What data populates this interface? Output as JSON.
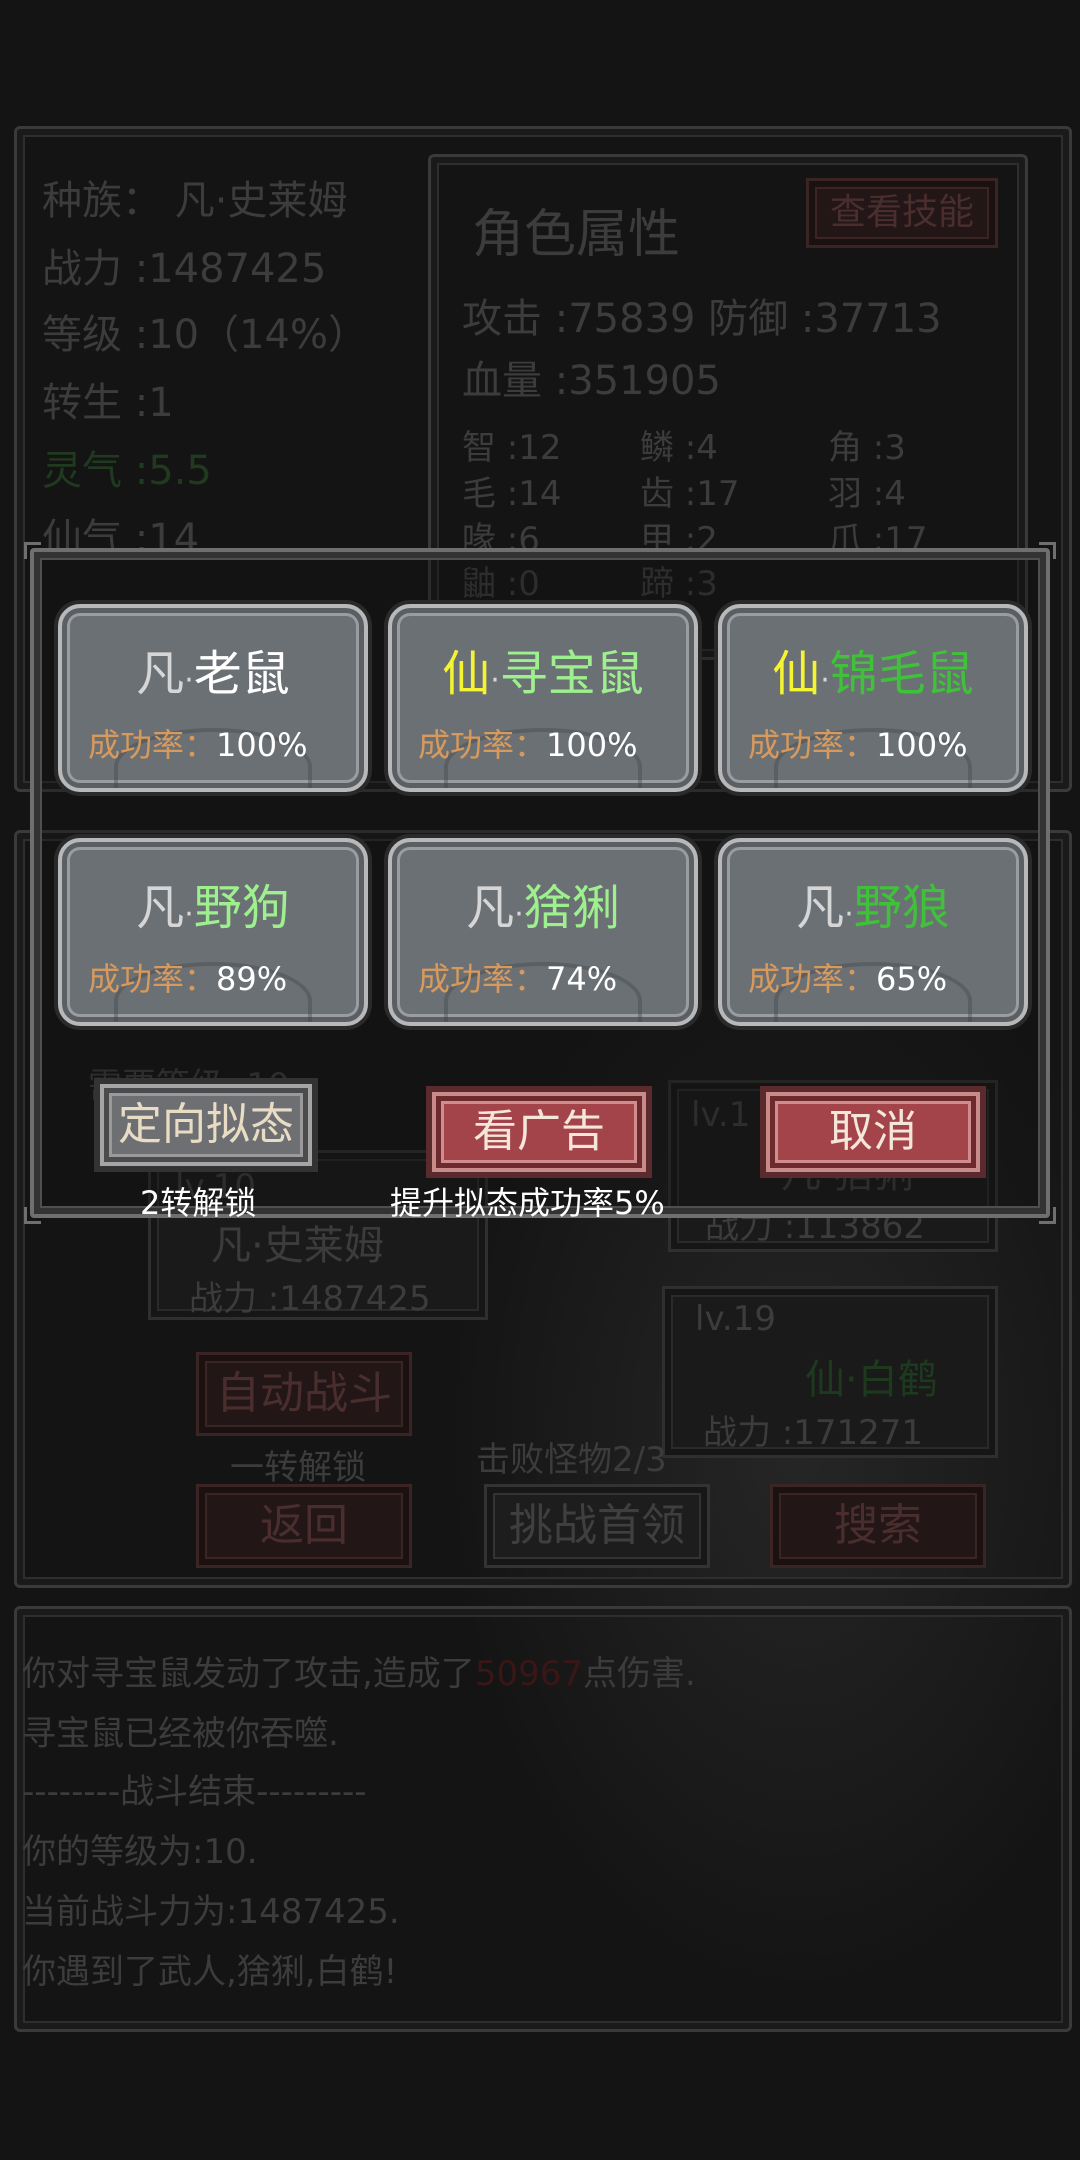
{
  "background": {
    "stats": [
      "种族：  凡·史莱姆",
      "战力 :1487425",
      "等级 :10（14%）",
      "转生 :1",
      "灵气 :5.5",
      "仙气 :14"
    ],
    "attributes": {
      "title": "角色属性",
      "skill_button": "查看技能",
      "attack_defense": "攻击 :75839   防御 :37713",
      "hp": "血量 :351905",
      "traits": [
        [
          "智 :12",
          "鳞 :4",
          "角 :3"
        ],
        [
          "毛 :14",
          "齿 :17",
          "羽 :4"
        ],
        [
          "喙 :6",
          "甲 :2",
          "爪 :17"
        ],
        [
          "鼬 :0",
          "蹄 :3",
          ""
        ]
      ]
    },
    "battle": {
      "level_req": "需要等级 :10",
      "player_card": {
        "level": "lv.10",
        "name": "凡·史莱姆",
        "power": "战力 :1487425"
      },
      "enemy_cards": [
        {
          "level": "lv.1",
          "name": "凡·猞猁",
          "power": "战力 :113862"
        },
        {
          "level": "lv.19",
          "name": "仙·白鹤",
          "power": "战力 :171271"
        }
      ],
      "auto_battle": "自动战斗",
      "auto_unlock": "一转解锁",
      "defeated": "击败怪物2/3",
      "back": "返回",
      "boss": "挑战首领",
      "search": "搜索"
    },
    "log": {
      "line1_pre": "你对寻宝鼠发动了攻击,造成了",
      "line1_damage": "50967",
      "line1_post": "点伤害.",
      "lines": [
        "寻宝鼠已经被你吞噬.",
        "--------战斗结束---------",
        "你的等级为:10.",
        "当前战斗力为:1487425.",
        "你遇到了武人,猞猁,白鹤!"
      ]
    }
  },
  "dialog": {
    "cards": [
      {
        "prefix": "凡",
        "prefix_color": "#d6d6d6",
        "name": "老鼠",
        "name_color": "#ffffff",
        "rate_label": "成功率：",
        "rate": "100%"
      },
      {
        "prefix": "仙",
        "prefix_color": "#f4f432",
        "name": "寻宝鼠",
        "name_color": "#9ef08e",
        "rate_label": "成功率：",
        "rate": "100%"
      },
      {
        "prefix": "仙",
        "prefix_color": "#f4f432",
        "name": "锦毛鼠",
        "name_color": "#3fc23a",
        "rate_label": "成功率：",
        "rate": "100%"
      },
      {
        "prefix": "凡",
        "prefix_color": "#d6d6d6",
        "name": "野狗",
        "name_color": "#9ef08e",
        "rate_label": "成功率：",
        "rate": "89%"
      },
      {
        "prefix": "凡",
        "prefix_color": "#d6d6d6",
        "name": "猞猁",
        "name_color": "#9ef08e",
        "rate_label": "成功率：",
        "rate": "74%"
      },
      {
        "prefix": "凡",
        "prefix_color": "#d6d6d6",
        "name": "野狼",
        "name_color": "#3fc23a",
        "rate_label": "成功率：",
        "rate": "65%"
      }
    ],
    "directed_button": "定向拟态",
    "directed_caption": "2转解锁",
    "ad_button": "看广告",
    "ad_caption": "提升拟态成功率5%",
    "cancel_button": "取消"
  }
}
